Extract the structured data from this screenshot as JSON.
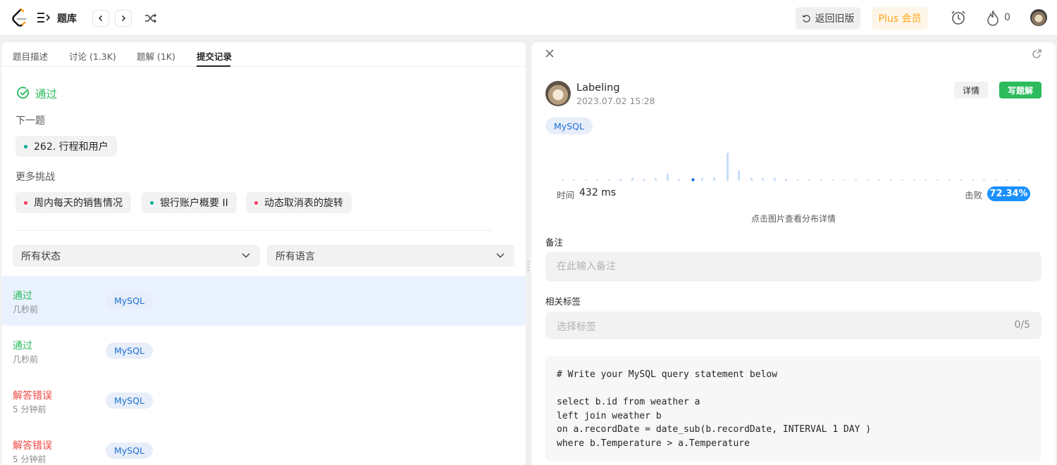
{
  "header": {
    "title": "题库",
    "back_old": "返回旧版",
    "plus": "Plus 会员",
    "streak": "0"
  },
  "left": {
    "tabs": [
      {
        "label": "题目描述"
      },
      {
        "label": "讨论 (1.3K)"
      },
      {
        "label": "题解 (1K)"
      },
      {
        "label": "提交记录"
      }
    ],
    "active_tab": "提交记录",
    "result": "通过",
    "next_label": "下一题",
    "next_problem": {
      "label": "262. 行程和用户",
      "dot_color": "#00af9b"
    },
    "more_label": "更多挑战",
    "challenges": [
      {
        "label": "周内每天的销售情况",
        "dot_color": "#ff375f"
      },
      {
        "label": "银行账户概要 II",
        "dot_color": "#00af9b"
      },
      {
        "label": "动态取消表的旋转",
        "dot_color": "#ff375f"
      }
    ],
    "status_filter": "所有状态",
    "lang_filter": "所有语言",
    "submissions": [
      {
        "status": "通过",
        "time": "几秒前",
        "lang": "MySQL",
        "color": "#2cbb5d"
      },
      {
        "status": "通过",
        "time": "几秒前",
        "lang": "MySQL",
        "color": "#2cbb5d"
      },
      {
        "status": "解答错误",
        "time": "5 分钟前",
        "lang": "MySQL",
        "color": "#ef4743"
      },
      {
        "status": "解答错误",
        "time": "5 分钟前",
        "lang": "MySQL",
        "color": "#ef4743"
      }
    ]
  },
  "right": {
    "username": "Labeling",
    "date": "2023.07.02 15:28",
    "detail_btn": "详情",
    "write_btn": "写题解",
    "lang": "MySQL",
    "runtime_label": "时间",
    "runtime_value": "432 ms",
    "beats_label": "击败",
    "beats_value": "72.34%",
    "hint": "点击图片查看分布详情",
    "note_label": "备注",
    "note_placeholder": "在此输入备注",
    "tags_label": "相关标签",
    "tags_placeholder": "选择标签",
    "tags_count": "0/5",
    "code": "# Write your MySQL query statement below\n\nselect b.id from weather a\nleft join weather b\non a.recordDate = date_sub(b.recordDate, INTERVAL 1 DAY )\nwhere b.Temperature > a.Temperature"
  },
  "colors": {
    "accent_green": "#2cbb5d",
    "error_red": "#ef4743",
    "blue": "#1a90ff",
    "plus_orange": "#ffa116"
  },
  "icons": [
    "leetcode-logo-icon",
    "list-icon",
    "chevron-left-icon",
    "chevron-right-icon",
    "shuffle-icon",
    "undo-icon",
    "alarm-clock-icon",
    "flame-icon",
    "check-circle-icon",
    "chevron-down-icon",
    "close-icon",
    "external-link-icon"
  ]
}
